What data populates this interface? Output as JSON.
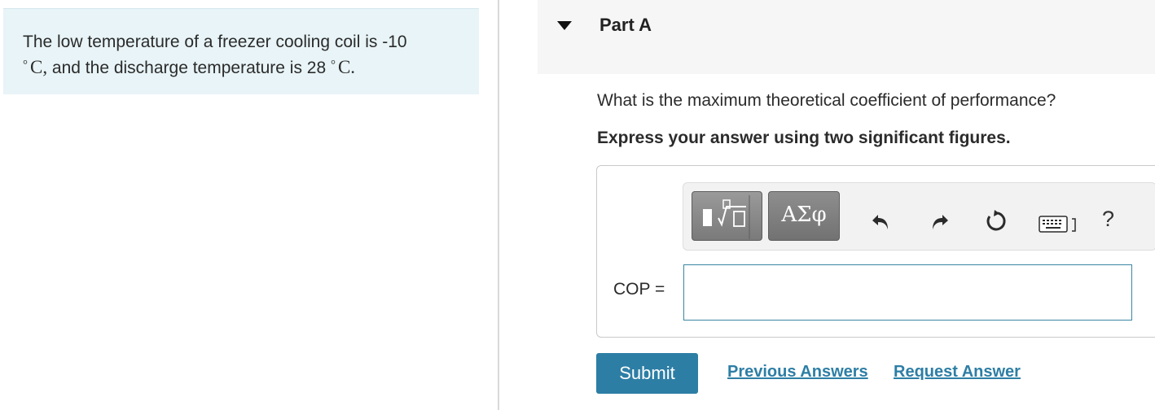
{
  "problem": {
    "line1_text": "The low temperature of a freezer cooling coil is -10",
    "line2_unit1": "C,",
    "line2_text": " and the discharge temperature is 28 ",
    "line2_unit2": "C.",
    "degree_symbol": "°"
  },
  "part": {
    "title": "Part A",
    "question": "What is the maximum theoretical coefficient of performance?",
    "instruction": "Express your answer using two significant figures."
  },
  "toolbar": {
    "symbols_label": "ΑΣφ",
    "help_label": "?",
    "icons": [
      "templates-icon",
      "undo-icon",
      "redo-icon",
      "reset-icon",
      "keyboard-icon",
      "help-icon"
    ]
  },
  "answer": {
    "variable_label": "COP =",
    "value": "",
    "placeholder": ""
  },
  "actions": {
    "submit_label": "Submit",
    "previous_answers_label": "Previous Answers",
    "request_answer_label": "Request Answer"
  },
  "colors": {
    "accent": "#2d7ea5",
    "statement_bg": "#e8f4f7"
  }
}
